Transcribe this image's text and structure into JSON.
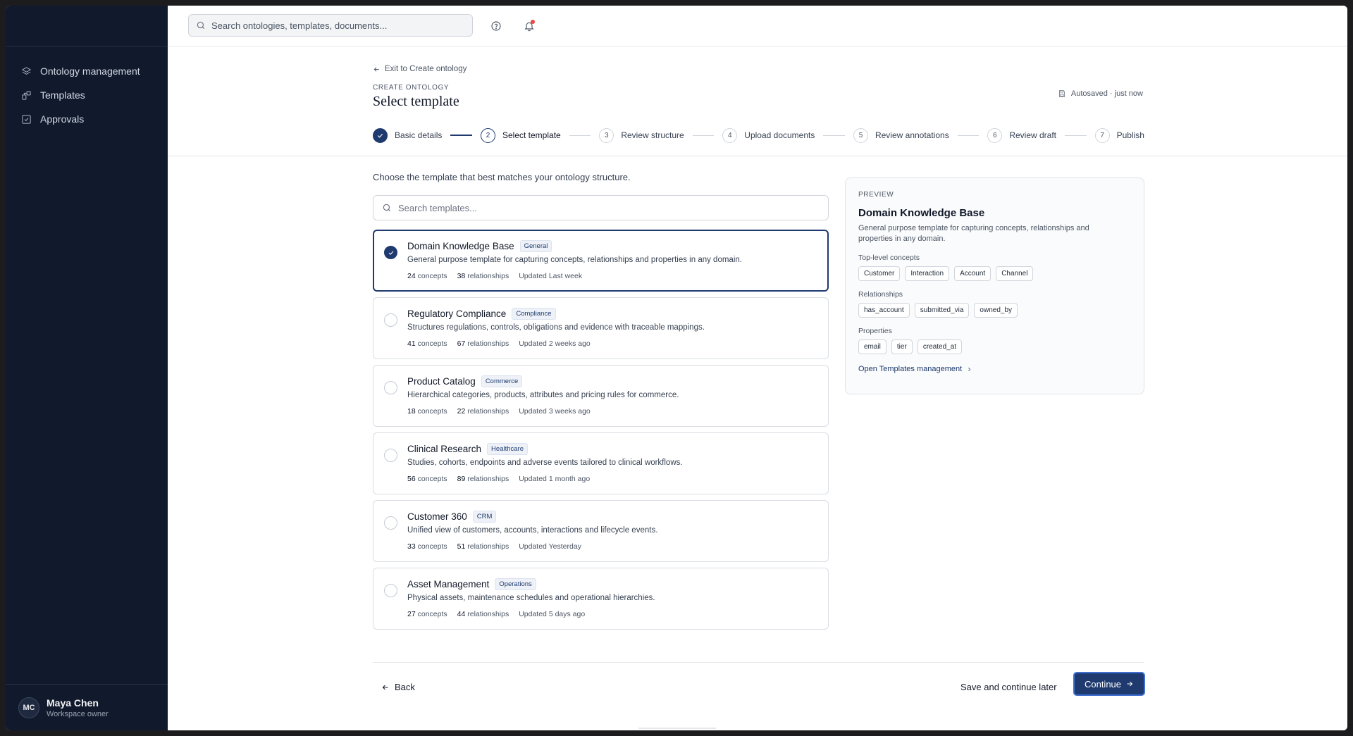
{
  "sidebar": {
    "items": [
      {
        "label": "Ontology management",
        "icon": "layers-icon"
      },
      {
        "label": "Templates",
        "icon": "templates-icon"
      },
      {
        "label": "Approvals",
        "icon": "check-square-icon"
      }
    ],
    "user": {
      "initials": "MC",
      "name": "Maya Chen",
      "role": "Workspace owner"
    }
  },
  "topbar": {
    "search_placeholder": "Search ontologies, templates, documents...",
    "help_icon": "help-circle-icon",
    "bell_icon": "bell-icon"
  },
  "header": {
    "exit_label": "Exit to Create ontology",
    "eyebrow": "CREATE ONTOLOGY",
    "title": "Select template",
    "autosave": "Autosaved · just now"
  },
  "steps": [
    {
      "number": "1",
      "label": "Basic details",
      "state": "done"
    },
    {
      "number": "2",
      "label": "Select template",
      "state": "active"
    },
    {
      "number": "3",
      "label": "Review structure",
      "state": "pending"
    },
    {
      "number": "4",
      "label": "Upload documents",
      "state": "pending"
    },
    {
      "number": "5",
      "label": "Review annotations",
      "state": "pending"
    },
    {
      "number": "6",
      "label": "Review draft",
      "state": "pending"
    },
    {
      "number": "7",
      "label": "Publish",
      "state": "pending"
    }
  ],
  "content": {
    "intro": "Choose the template that best matches your ontology structure.",
    "search_placeholder": "Search templates..."
  },
  "templates": [
    {
      "name": "Domain Knowledge Base",
      "tag": "General",
      "description": "General purpose template for capturing concepts, relationships and properties in any domain.",
      "concepts": "24",
      "relationships": "38",
      "updated": "Updated Last week",
      "selected": true
    },
    {
      "name": "Regulatory Compliance",
      "tag": "Compliance",
      "description": "Structures regulations, controls, obligations and evidence with traceable mappings.",
      "concepts": "41",
      "relationships": "67",
      "updated": "Updated 2 weeks ago",
      "selected": false
    },
    {
      "name": "Product Catalog",
      "tag": "Commerce",
      "description": "Hierarchical categories, products, attributes and pricing rules for commerce.",
      "concepts": "18",
      "relationships": "22",
      "updated": "Updated 3 weeks ago",
      "selected": false
    },
    {
      "name": "Clinical Research",
      "tag": "Healthcare",
      "description": "Studies, cohorts, endpoints and adverse events tailored to clinical workflows.",
      "concepts": "56",
      "relationships": "89",
      "updated": "Updated 1 month ago",
      "selected": false
    },
    {
      "name": "Customer 360",
      "tag": "CRM",
      "description": "Unified view of customers, accounts, interactions and lifecycle events.",
      "concepts": "33",
      "relationships": "51",
      "updated": "Updated Yesterday",
      "selected": false
    },
    {
      "name": "Asset Management",
      "tag": "Operations",
      "description": "Physical assets, maintenance schedules and operational hierarchies.",
      "concepts": "27",
      "relationships": "44",
      "updated": "Updated 5 days ago",
      "selected": false
    }
  ],
  "template_meta_labels": {
    "concepts": "concepts",
    "relationships": "relationships"
  },
  "preview": {
    "eyebrow": "PREVIEW",
    "title": "Domain Knowledge Base",
    "description": "General purpose template for capturing concepts, relationships and properties in any domain.",
    "concepts_label": "Top-level concepts",
    "concepts": [
      "Customer",
      "Interaction",
      "Account",
      "Channel"
    ],
    "relationships_label": "Relationships",
    "relationships": [
      "has_account",
      "submitted_via",
      "owned_by"
    ],
    "properties_label": "Properties",
    "properties": [
      "email",
      "tier",
      "created_at"
    ],
    "link": "Open Templates management"
  },
  "footer": {
    "back": "Back",
    "save_later": "Save and continue later",
    "continue": "Continue"
  },
  "colors": {
    "accent": "#1e3a6e",
    "sidebar_bg": "#111a2c",
    "notification": "#ef4444"
  }
}
